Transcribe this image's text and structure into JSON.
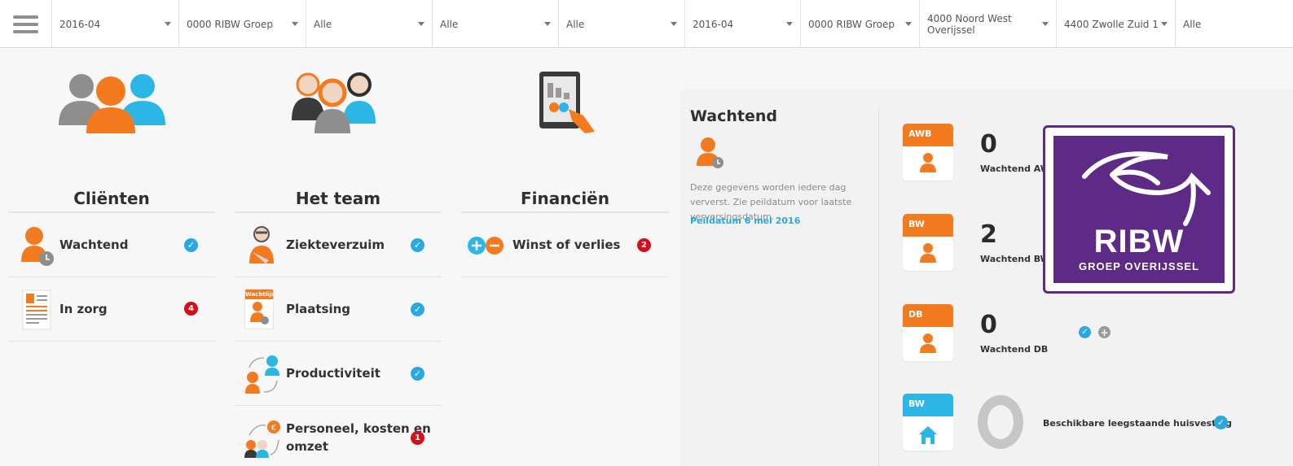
{
  "filters": [
    {
      "value": "2016-04",
      "has_caret": true
    },
    {
      "value": "0000 RIBW Groep",
      "has_caret": true
    },
    {
      "value": "Alle",
      "has_caret": true
    },
    {
      "value": "Alle",
      "has_caret": true
    },
    {
      "value": "Alle",
      "has_caret": true
    },
    {
      "value": "2016-04",
      "has_caret": true
    },
    {
      "value": "0000 RIBW Groep",
      "has_caret": true
    },
    {
      "value": "4000 Noord West Overijssel",
      "has_caret": true
    },
    {
      "value": "4400 Zwolle Zuid 1",
      "has_caret": true
    },
    {
      "value": "Alle",
      "has_caret": false
    }
  ],
  "columns": {
    "clients": {
      "title": "Cliënten",
      "items": [
        {
          "label": "Wachtend",
          "status": "check",
          "status_text": "✓",
          "icon": "waiting-person-icon"
        },
        {
          "label": "In zorg",
          "status": "badge",
          "status_text": "4",
          "icon": "care-document-icon"
        }
      ]
    },
    "team": {
      "title": "Het team",
      "items": [
        {
          "label": "Ziekteverzuim",
          "status": "check",
          "status_text": "✓",
          "icon": "sick-person-icon"
        },
        {
          "label": "Plaatsing",
          "status": "check",
          "status_text": "✓",
          "icon": "waiting-list-icon",
          "icon_text": "Wachtlijst"
        },
        {
          "label": "Productiviteit",
          "status": "check",
          "status_text": "✓",
          "icon": "productivity-icon"
        },
        {
          "label_line1": "Personeel, kosten en",
          "label_line2": "omzet",
          "status": "badge",
          "status_text": "1",
          "icon": "personnel-costs-icon"
        }
      ]
    },
    "finance": {
      "title": "Financiën",
      "items": [
        {
          "label": "Winst of verlies",
          "status": "badge",
          "status_text": "2",
          "icon": "plus-minus-icon"
        }
      ]
    }
  },
  "detail": {
    "title": "Wachtend",
    "description": "Deze gegevens worden iedere dag ververst. Zie peildatum voor laatste verversingsdatum.",
    "date_link": "Peildatum 6 mei 2016",
    "metrics": [
      {
        "tile": "AWB",
        "value": "0",
        "label": "Wachtend AWB"
      },
      {
        "tile": "BW",
        "value": "2",
        "label": "Wachtend BW"
      },
      {
        "tile": "DB",
        "value": "0",
        "label": "Wachtend DB"
      }
    ],
    "housing": {
      "tile": "BW",
      "label": "Beschikbare leegstaande huisvesting"
    },
    "logo": {
      "brand": "RIBW",
      "sub": "GROEP OVERIJSSEL"
    },
    "action_check": "✓",
    "action_add": "+"
  },
  "colors": {
    "accent_blue": "#2ba8e0",
    "accent_orange": "#f47a20",
    "alert_red": "#d40f1a",
    "logo_purple": "#5d2a86"
  }
}
